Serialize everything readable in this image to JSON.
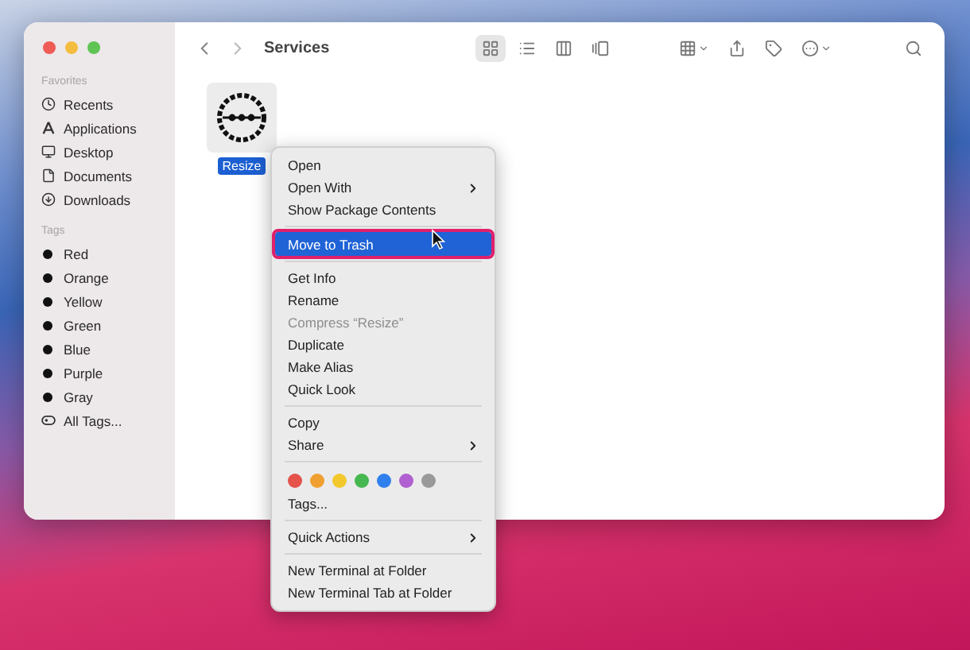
{
  "window": {
    "title": "Services"
  },
  "view_modes": [
    {
      "selected": true
    },
    {
      "selected": false
    },
    {
      "selected": false
    },
    {
      "selected": false
    }
  ],
  "sidebar": {
    "sections": [
      {
        "heading": "Favorites",
        "items": [
          {
            "label": "Recents",
            "kind": "place"
          },
          {
            "label": "Applications",
            "kind": "place"
          },
          {
            "label": "Desktop",
            "kind": "place"
          },
          {
            "label": "Documents",
            "kind": "place"
          },
          {
            "label": "Downloads",
            "kind": "place"
          }
        ]
      },
      {
        "heading": "Tags",
        "items": [
          {
            "label": "Red",
            "kind": "tag"
          },
          {
            "label": "Orange",
            "kind": "tag"
          },
          {
            "label": "Yellow",
            "kind": "tag"
          },
          {
            "label": "Green",
            "kind": "tag"
          },
          {
            "label": "Blue",
            "kind": "tag"
          },
          {
            "label": "Purple",
            "kind": "tag"
          },
          {
            "label": "Gray",
            "kind": "tag"
          },
          {
            "label": "All Tags...",
            "kind": "all-tags"
          }
        ]
      }
    ]
  },
  "files": [
    {
      "name": "Resize",
      "selected": true
    }
  ],
  "context_menu": {
    "groups": [
      {
        "kind": "items",
        "items": [
          {
            "label": "Open",
            "submenu": false,
            "disabled": false,
            "selected": false
          },
          {
            "label": "Open With",
            "submenu": true,
            "disabled": false,
            "selected": false
          },
          {
            "label": "Show Package Contents",
            "submenu": false,
            "disabled": false,
            "selected": false
          }
        ]
      },
      {
        "kind": "items",
        "items": [
          {
            "label": "Move to Trash",
            "submenu": false,
            "disabled": false,
            "selected": true
          }
        ]
      },
      {
        "kind": "items",
        "items": [
          {
            "label": "Get Info",
            "submenu": false,
            "disabled": false,
            "selected": false
          },
          {
            "label": "Rename",
            "submenu": false,
            "disabled": false,
            "selected": false
          },
          {
            "label": "Compress “Resize”",
            "submenu": false,
            "disabled": true,
            "selected": false
          },
          {
            "label": "Duplicate",
            "submenu": false,
            "disabled": false,
            "selected": false
          },
          {
            "label": "Make Alias",
            "submenu": false,
            "disabled": false,
            "selected": false
          },
          {
            "label": "Quick Look",
            "submenu": false,
            "disabled": false,
            "selected": false
          }
        ]
      },
      {
        "kind": "items",
        "items": [
          {
            "label": "Copy",
            "submenu": false,
            "disabled": false,
            "selected": false
          },
          {
            "label": "Share",
            "submenu": true,
            "disabled": false,
            "selected": false
          }
        ]
      },
      {
        "kind": "tags",
        "colors": [
          {
            "color": "#e5534b"
          },
          {
            "color": "#f0a030"
          },
          {
            "color": "#f2c82e"
          },
          {
            "color": "#45b850"
          },
          {
            "color": "#2f80ed"
          },
          {
            "color": "#b060d0"
          },
          {
            "color": "#999999"
          }
        ],
        "items": [
          {
            "label": "Tags...",
            "submenu": false,
            "disabled": false,
            "selected": false
          }
        ]
      },
      {
        "kind": "items",
        "items": [
          {
            "label": "Quick Actions",
            "submenu": true,
            "disabled": false,
            "selected": false
          }
        ]
      },
      {
        "kind": "items",
        "items": [
          {
            "label": "New Terminal at Folder",
            "submenu": false,
            "disabled": false,
            "selected": false
          },
          {
            "label": "New Terminal Tab at Folder",
            "submenu": false,
            "disabled": false,
            "selected": false
          }
        ]
      }
    ]
  }
}
